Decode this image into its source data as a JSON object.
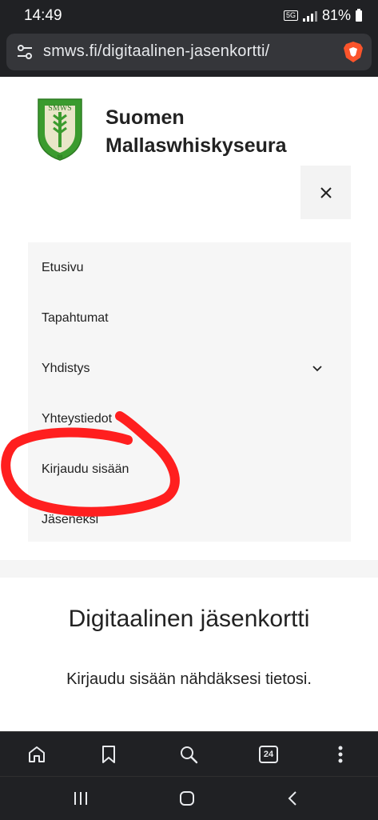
{
  "status_bar": {
    "time": "14:49",
    "network": "5G",
    "battery": "81%"
  },
  "browser": {
    "url": "smws.fi/digitaalinen-jasenkortti/",
    "tab_count": "24"
  },
  "header": {
    "site_title_line1": "Suomen",
    "site_title_line2": "Mallaswhiskyseura"
  },
  "menu": {
    "items": [
      {
        "label": "Etusivu"
      },
      {
        "label": "Tapahtumat"
      },
      {
        "label": "Yhdistys"
      },
      {
        "label": "Yhteystiedot"
      },
      {
        "label": "Kirjaudu sisään"
      },
      {
        "label": "Jäseneksi"
      }
    ]
  },
  "main": {
    "title": "Digitaalinen jäsenkortti",
    "subtitle": "Kirjaudu sisään nähdäksesi tietosi."
  },
  "colors": {
    "annotation": "#ff1f1f",
    "chrome": "#202124",
    "brave": "#fb542b",
    "logo_green": "#3b9b2e"
  }
}
